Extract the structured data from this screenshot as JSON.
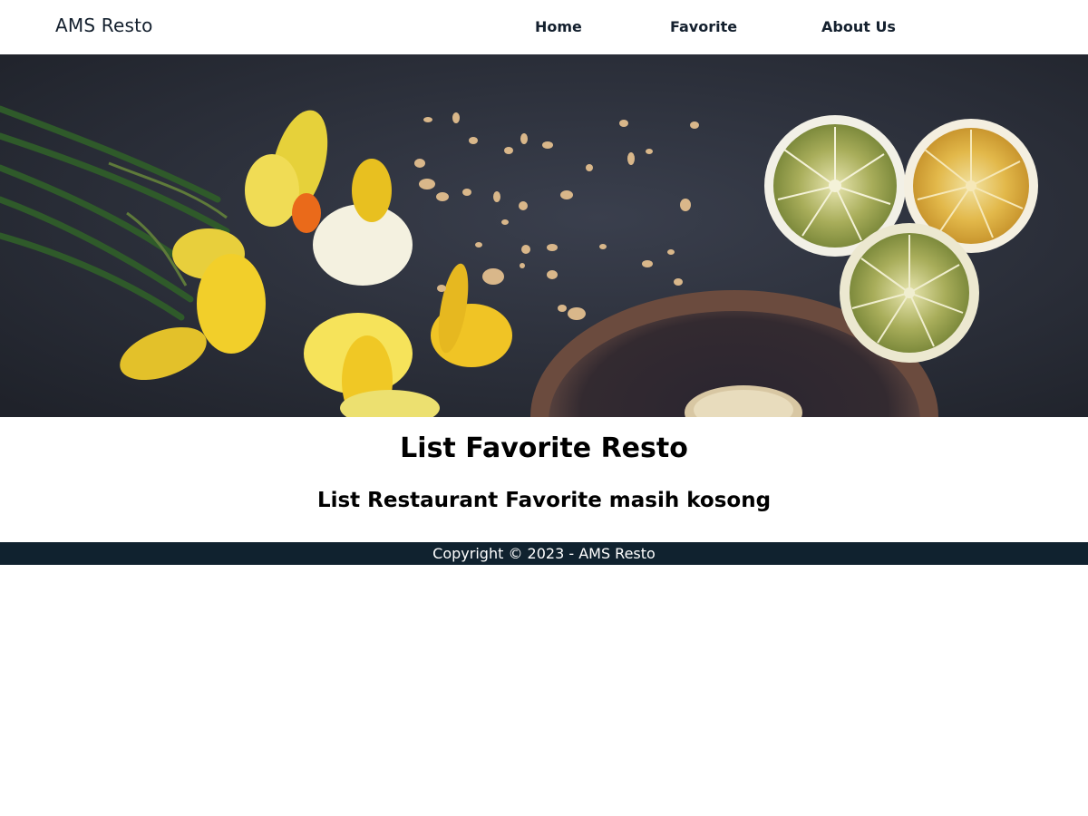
{
  "navbar": {
    "brand": "AMS Resto",
    "links": [
      {
        "label": "Home"
      },
      {
        "label": "Favorite"
      },
      {
        "label": "About Us"
      }
    ]
  },
  "hero": {
    "image": "flowers-lemons-on-dark-table-photo"
  },
  "main": {
    "title": "List Favorite Resto",
    "empty_message": "List Restaurant Favorite masih kosong"
  },
  "footer": {
    "copyright": "Copyright © 2023 - AMS Resto"
  },
  "colors": {
    "nav_text": "#14202e",
    "footer_bg": "#10222f",
    "hero_bg": "#2b2f3a"
  }
}
